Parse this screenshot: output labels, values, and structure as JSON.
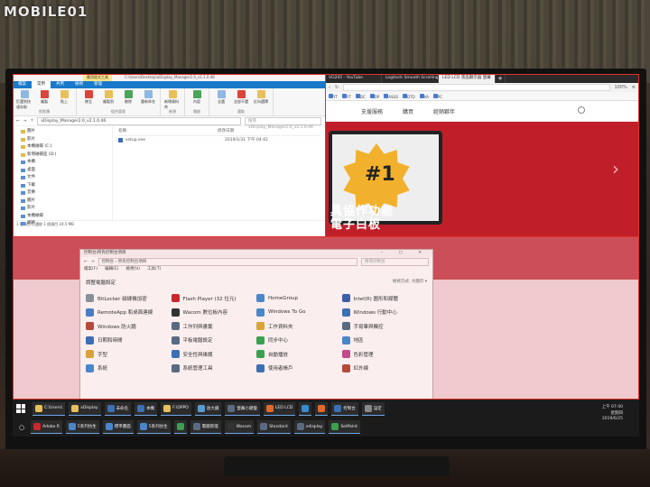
{
  "watermark": "MOBILE01",
  "explorer": {
    "title_context": "應用程式工具",
    "title_path": "C:\\Users\\Desktop\\xDisplay_Manager2.0_v2.1.0.46",
    "tabs": [
      "檔案",
      "常用",
      "共用",
      "檢視",
      "管理"
    ],
    "ribbon": [
      {
        "group": "剪貼簿",
        "buttons": [
          "釘選到快速存取",
          "複製",
          "貼上"
        ]
      },
      {
        "group": "組合管理",
        "buttons": [
          "移至",
          "複製到",
          "刪除",
          "重新命名"
        ]
      },
      {
        "group": "新增",
        "buttons": [
          "新增資料夾"
        ]
      },
      {
        "group": "開啟",
        "buttons": [
          "內容"
        ]
      },
      {
        "group": "選取",
        "buttons": [
          "全選",
          "全部不選",
          "反向選擇"
        ]
      }
    ],
    "address": "xDisplay_Manager2.0_v2.1.0.46",
    "search_placeholder": "搜尋 xDisplay_Manager2.0_v2.1.0.46",
    "nav": [
      "圖片",
      "影片",
      "本機磁碟 (C:)",
      "新增磁碟區 (D:)",
      "本機",
      "桌面",
      "文件",
      "下載",
      "音樂",
      "圖片",
      "影片",
      "本機磁碟",
      "網路"
    ],
    "columns": [
      "名稱",
      "修改日期"
    ],
    "files": [
      {
        "name": "setup.exe",
        "date": "2019/1/31 下午 04:42"
      }
    ],
    "status": "1 個項目    已選取 1 個項目 24.5 MB"
  },
  "browser": {
    "tabs": [
      "VG245 - YouTube",
      "Logitech Smooth Scrolling",
      "LED LCD 液晶顯示器 螢幕"
    ],
    "plus": "+",
    "zoom": "100%",
    "bookmarks": [
      "YT",
      "YT",
      "DC",
      "OP",
      "ASUS",
      "DTO",
      "VA",
      "PC"
    ],
    "nav": [
      "支援服務",
      "購買",
      "經銷夥伴"
    ],
    "hero_number": "#1",
    "hero_title_1": "具協作功能",
    "hero_title_2": "電子白板",
    "arrow": "›"
  },
  "control_panel": {
    "title": "控制台\\所有控制台項目",
    "controls": "–  ▢  ✕",
    "address": "控制台 › 所有控制台項目",
    "search_placeholder": "搜尋控制台",
    "menu": [
      "檔案(F)",
      "編輯(E)",
      "檢視(V)",
      "工具(T)"
    ],
    "heading": "調整電腦設定",
    "view_label": "檢視方式: 大圖示 ▾",
    "items": [
      {
        "label": "BitLocker 磁碟機加密",
        "color": "#8a8f98"
      },
      {
        "label": "Flash Player (32 位元)",
        "color": "#c8282e"
      },
      {
        "label": "HomeGroup",
        "color": "#4a86c9"
      },
      {
        "label": "Intel(R) 圖形和媒體",
        "color": "#3d5fa8"
      },
      {
        "label": "RemoteApp 和桌面連線",
        "color": "#4a7cc4"
      },
      {
        "label": "Wacom 數位板內容",
        "color": "#333333"
      },
      {
        "label": "Windows To Go",
        "color": "#4a86c9"
      },
      {
        "label": "Windows 行動中心",
        "color": "#3d6fb4"
      },
      {
        "label": "Windows 防火牆",
        "color": "#b34a3a"
      },
      {
        "label": "工作列與書籤",
        "color": "#5a6a80"
      },
      {
        "label": "工作資料夾",
        "color": "#d8a43a"
      },
      {
        "label": "手寫筆與觸控",
        "color": "#5a6a80"
      },
      {
        "label": "日期和時間",
        "color": "#3d6fb4"
      },
      {
        "label": "平板電腦設定",
        "color": "#5a6a80"
      },
      {
        "label": "同步中心",
        "color": "#3aa050"
      },
      {
        "label": "地區",
        "color": "#4a86c9"
      },
      {
        "label": "字型",
        "color": "#d8a43a"
      },
      {
        "label": "安全性與維護",
        "color": "#3d6fb4"
      },
      {
        "label": "自動播放",
        "color": "#3aa050"
      },
      {
        "label": "色彩管理",
        "color": "#c04a8a"
      },
      {
        "label": "系統",
        "color": "#4a86c9"
      },
      {
        "label": "系統管理工具",
        "color": "#5a6a80"
      },
      {
        "label": "使用者帳戶",
        "color": "#3d6fb4"
      },
      {
        "label": "紅外線",
        "color": "#b34a3a"
      }
    ]
  },
  "taskbar": {
    "row1": [
      {
        "label": "C:\\Users\\",
        "color": "#e8c05a"
      },
      {
        "label": "xDisplay",
        "color": "#e8c05a"
      },
      {
        "label": "未命名",
        "color": "#3d6fb4"
      },
      {
        "label": "本機",
        "color": "#3d6fb4"
      },
      {
        "label": "F:\\OPPO",
        "color": "#e8c05a"
      },
      {
        "label": "放大鏡",
        "color": "#5a9ad0"
      },
      {
        "label": "螢幕小鍵盤",
        "color": "#5a6a80"
      },
      {
        "label": "LED LCD",
        "color": "#e06a2a"
      },
      {
        "label": "",
        "color": "#3a8ad0"
      },
      {
        "label": "",
        "color": "#e06a2a"
      },
      {
        "label": "控制台",
        "color": "#3d6fb4"
      },
      {
        "label": "設定",
        "color": "#888888"
      }
    ],
    "row2": [
      {
        "label": "Adobe R",
        "color": "#c8282e"
      },
      {
        "label": "5系列仿生",
        "color": "#4a86c9"
      },
      {
        "label": "標準畫面",
        "color": "#4a86c9"
      },
      {
        "label": "5系列仿生",
        "color": "#4a86c9"
      },
      {
        "label": "",
        "color": "#3aa050"
      },
      {
        "label": "電腦管理",
        "color": "#5a6a80"
      },
      {
        "label": "Wacom",
        "color": "#333333"
      },
      {
        "label": "Standard",
        "color": "#5a6a80"
      },
      {
        "label": "xdisplay",
        "color": "#5a6a80"
      },
      {
        "label": "SetPoint",
        "color": "#3aa050"
      }
    ],
    "time": "上午 07:40",
    "weekday": "星期四",
    "date": "2019/6/25"
  }
}
